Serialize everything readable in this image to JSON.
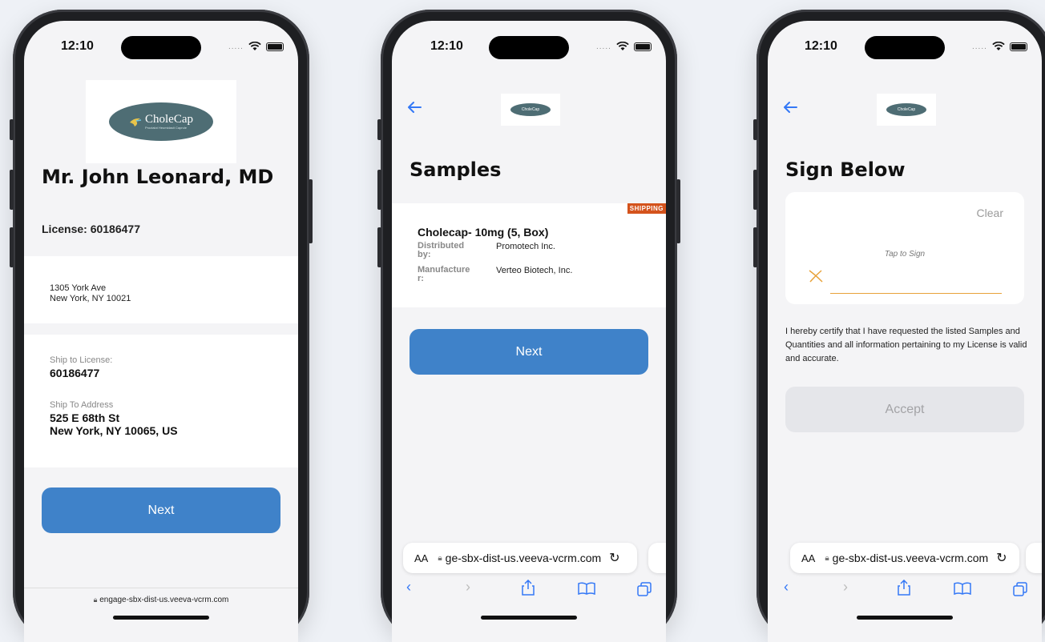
{
  "status": {
    "time": "12:10",
    "dots": "....."
  },
  "phone1": {
    "logo_text": "CholeCap",
    "logo_subtext": "Proctalot Heumidasit Caprule",
    "name": "Mr. John Leonard, MD",
    "license": "License: 60186477",
    "address_line1": "1305 York Ave",
    "address_line2": "New York, NY 10021",
    "ship_license_label": "Ship to License:",
    "ship_license_value": "60186477",
    "ship_address_label": "Ship To Address",
    "ship_address_line1": "525 E 68th St",
    "ship_address_line2": "New York, NY 10065, US",
    "next_label": "Next",
    "url": "engage-sbx-dist-us.veeva-vcrm.com"
  },
  "phone2": {
    "title": "Samples",
    "badge": "SHIPPING",
    "product": "Cholecap- 10mg (5, Box)",
    "distributed_label": "Distributed by:",
    "distributed_value": "Promotech Inc.",
    "manufacturer_label": "Manufacturer:",
    "manufacturer_value": "Verteo Biotech, Inc.",
    "next_label": "Next",
    "aa": "AA",
    "url": "ge-sbx-dist-us.veeva-vcrm.com"
  },
  "phone3": {
    "title": "Sign Below",
    "clear_label": "Clear",
    "tap_to_sign": "Tap to Sign",
    "certify": "I hereby certify that I have requested the listed Samples and Quantities and all information pertaining to my License is valid and accurate.",
    "accept_label": "Accept",
    "aa": "AA",
    "url": "ge-sbx-dist-us.veeva-vcrm.com"
  },
  "colors": {
    "blue": "#3f82c9",
    "orange_badge": "#d4531c",
    "sign_line": "#e8a23a",
    "accent_link": "#3478f6"
  }
}
